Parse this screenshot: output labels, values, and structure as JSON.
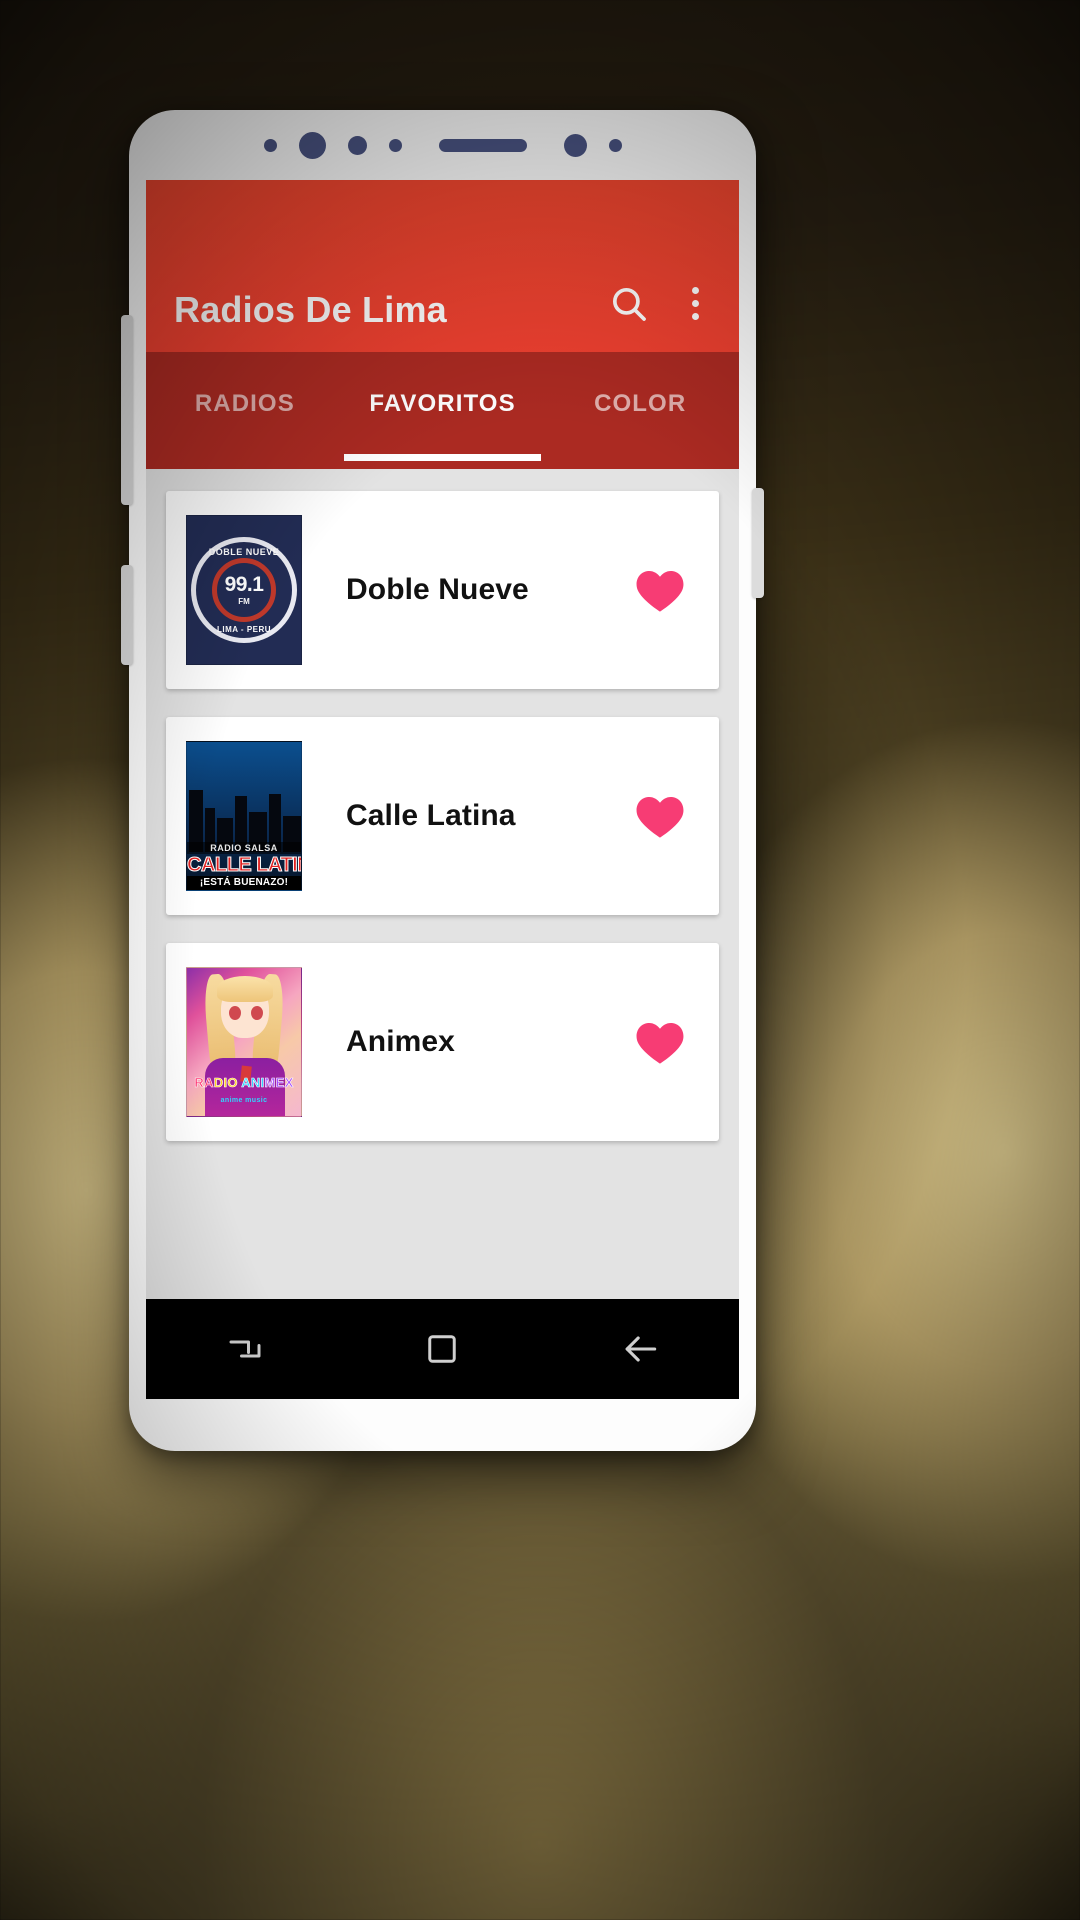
{
  "device": {
    "frame": "android-phone-mockup",
    "sensors": [
      "dot-small",
      "dot-large",
      "dot-medium",
      "dot-small",
      "earpiece-speaker",
      "dot-large",
      "dot-small"
    ]
  },
  "app": {
    "title": "Radios De Lima",
    "appbar_color": "#ee4030",
    "tabbar_color": "#ab2a22",
    "accent_heart_color": "#f73c74",
    "actions": [
      {
        "name": "search-icon",
        "label": "Buscar"
      },
      {
        "name": "overflow-menu-icon",
        "label": "Más opciones"
      }
    ]
  },
  "tabs": [
    {
      "label": "RADIOS",
      "active": false
    },
    {
      "label": "FAVORITOS",
      "active": true
    },
    {
      "label": "COLOR",
      "active": false
    }
  ],
  "stations": [
    {
      "name": "Doble Nueve",
      "favorite": true,
      "logo": {
        "style": "doble-nueve",
        "arc_top": "DOBLE NUEVE",
        "frequency": "99.1",
        "band": "FM",
        "arc_bottom": "LIMA - PERU",
        "bg": "#222c54"
      }
    },
    {
      "name": "Calle Latina",
      "favorite": true,
      "logo": {
        "style": "calle-latina",
        "line1": "RADIO SALSA",
        "line2": "CALLE LATINA",
        "line3": "¡ESTÁ BUENAZO!",
        "bg": "#0a2a52"
      }
    },
    {
      "name": "Animex",
      "favorite": true,
      "logo": {
        "style": "animex",
        "line1": "RADIO ANIMEX",
        "line2": "anime music",
        "bg": "#e0519b"
      }
    }
  ],
  "navbar": [
    {
      "name": "recents-button",
      "label": "Recientes"
    },
    {
      "name": "home-button",
      "label": "Inicio"
    },
    {
      "name": "back-button",
      "label": "Atrás"
    }
  ]
}
